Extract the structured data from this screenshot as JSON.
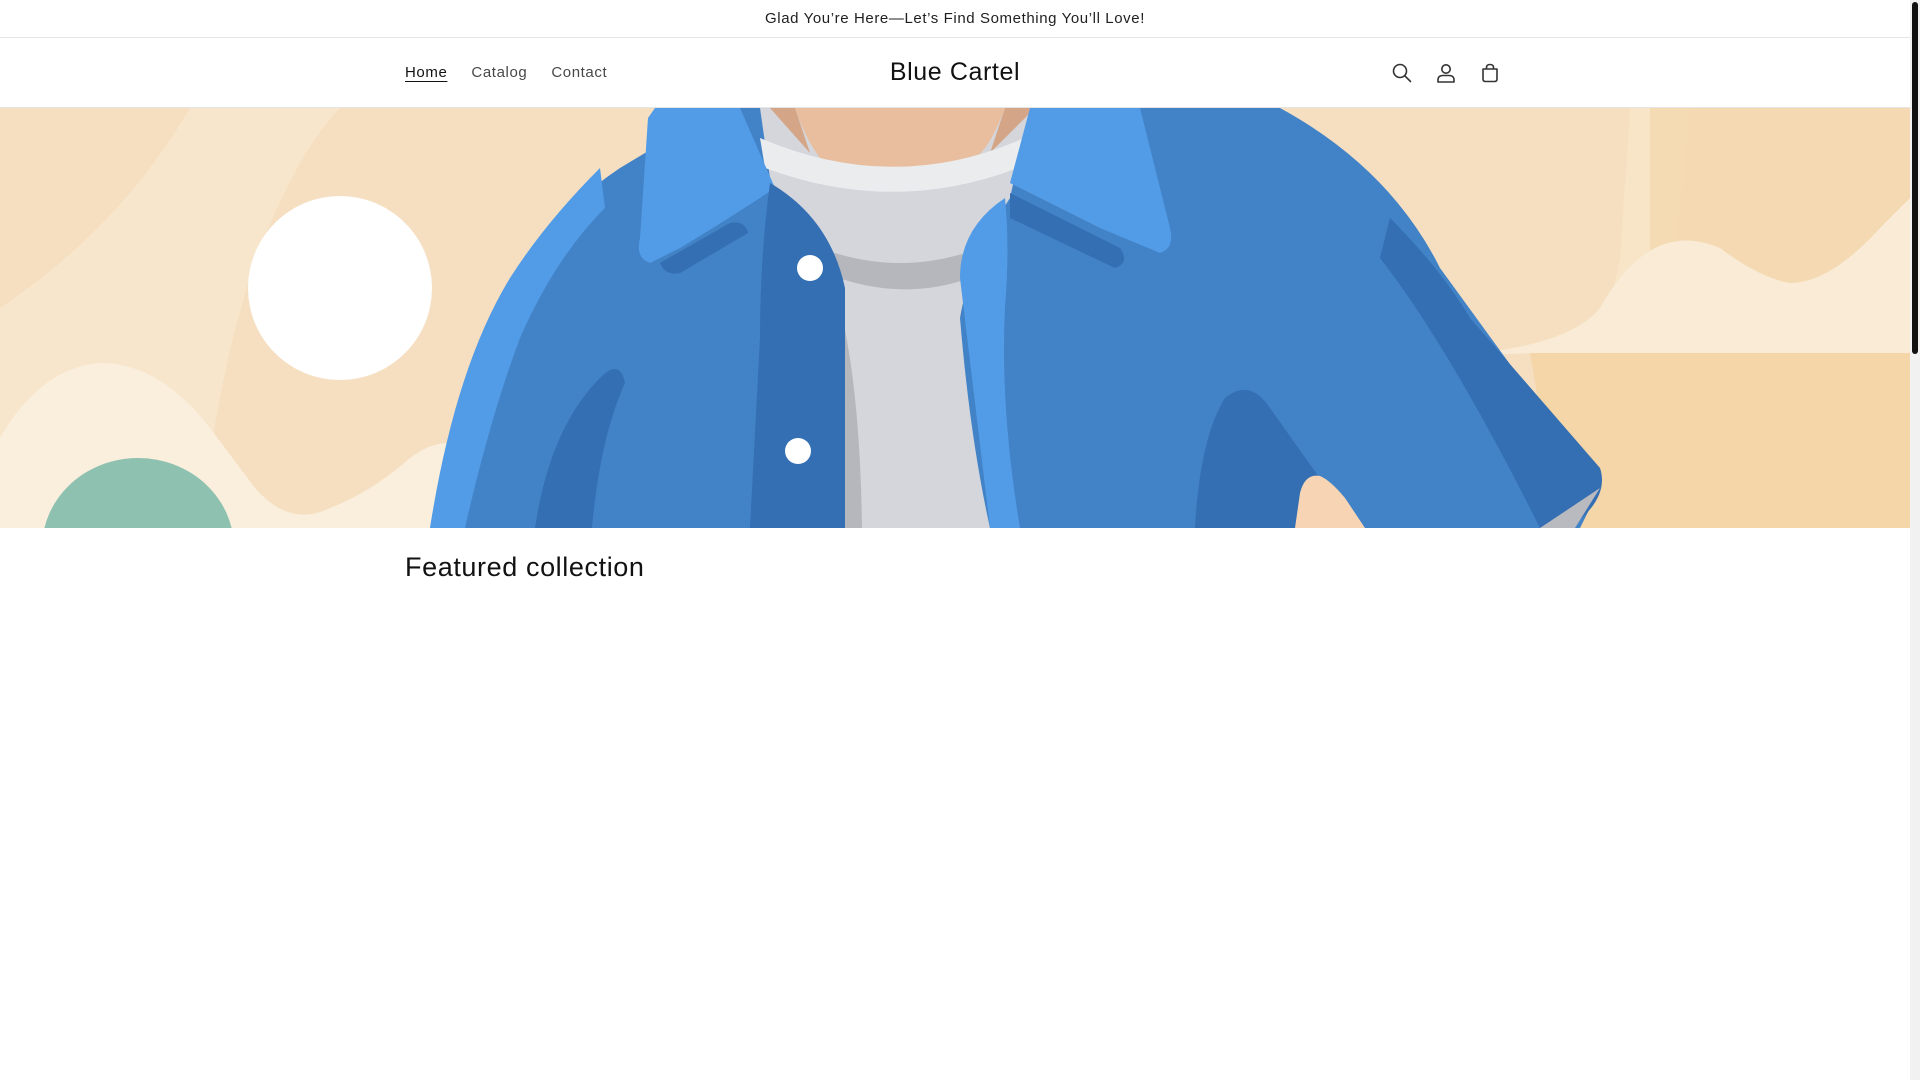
{
  "announcement": {
    "text": "Glad You’re Here—Let’s Find Something You’ll Love!"
  },
  "header": {
    "nav": [
      {
        "label": "Home",
        "active": true
      },
      {
        "label": "Catalog",
        "active": false
      },
      {
        "label": "Contact",
        "active": false
      }
    ],
    "brand": "Blue Cartel",
    "icons": [
      "search-icon",
      "account-icon",
      "cart-icon"
    ]
  },
  "hero": {
    "colors": {
      "background": "#f5dfc0",
      "cream": "#faeedd",
      "jacket": "#4282c6",
      "jacket_light": "#529be6",
      "jacket_dark": "#346eb3",
      "shirt": "#d4d6db",
      "shirt_shadow": "#b5b7bc",
      "skin": "#e9be9e",
      "green": "#8fc1b1",
      "sun": "#ffffff"
    }
  },
  "main": {
    "featured_title": "Featured collection"
  }
}
